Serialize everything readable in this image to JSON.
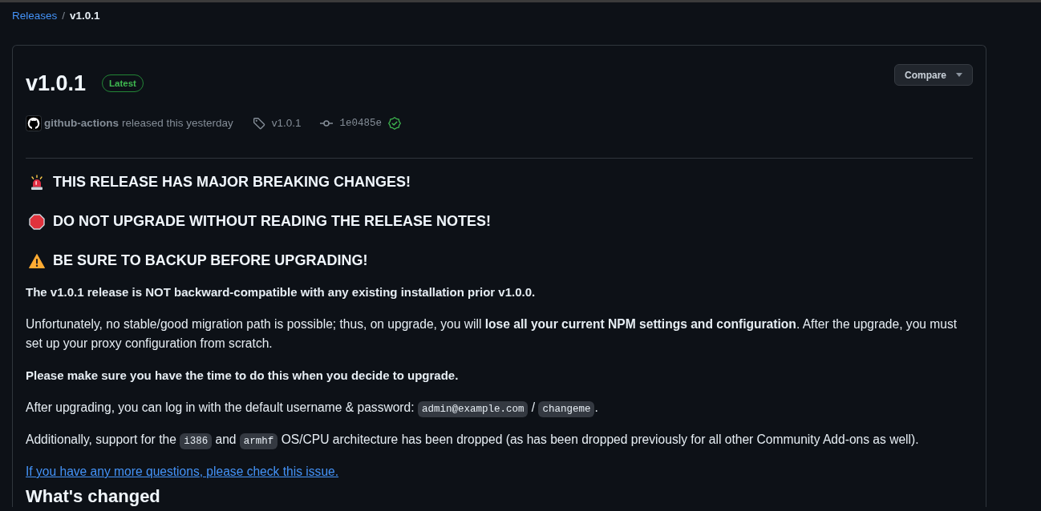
{
  "breadcrumb": {
    "separator": "/",
    "items": [
      {
        "label": "Releases",
        "current": false
      },
      {
        "label": "v1.0.1",
        "current": true
      }
    ]
  },
  "release": {
    "title": "v1.0.1",
    "badge": "Latest",
    "compare_button": {
      "label": "Compare"
    },
    "author": "github-actions",
    "action": "released this yesterday",
    "tag": "v1.0.1",
    "commit": "1e0485e",
    "verified": true
  },
  "body": [
    {
      "kind": "siren",
      "text": "THIS RELEASE HAS MAJOR BREAKING CHANGES!"
    },
    {
      "kind": "stop",
      "text": "DO NOT UPGRADE WITHOUT READING THE RELEASE NOTES!"
    },
    {
      "kind": "warning",
      "text": "BE SURE TO BACKUP BEFORE UPGRADING!"
    },
    {
      "kind": "paragraph",
      "bold": true,
      "text": "The v1.0.1 release is NOT backward-compatible with any existing installation prior v1.0.0."
    },
    {
      "kind": "paragraph",
      "bold": false,
      "text": "Unfortunately, no stable/good migration path is possible; thus, on upgrade, you will **lose all your current NPM settings and configuration**. After the upgrade, you must set up your proxy configuration from scratch."
    },
    {
      "kind": "paragraph",
      "bold": true,
      "text": "Please make sure you have the time to do this when you decide to upgrade."
    },
    {
      "kind": "mixed",
      "parts": [
        {
          "kind": "text",
          "text": "After upgrading, you can log in with the default username & password: "
        },
        {
          "kind": "code",
          "text": "admin@example.com"
        },
        {
          "kind": "text",
          "text": " / "
        },
        {
          "kind": "code",
          "text": "changeme"
        },
        {
          "kind": "text",
          "text": "."
        }
      ]
    },
    {
      "kind": "mixed",
      "parts": [
        {
          "kind": "text",
          "text": "Additionally, support for the "
        },
        {
          "kind": "code",
          "text": "i386"
        },
        {
          "kind": "text",
          "text": " and "
        },
        {
          "kind": "code",
          "text": "armhf"
        },
        {
          "kind": "text",
          "text": " OS/CPU architecture has been dropped (as has been dropped previously for all other Community Add-ons as well)."
        }
      ]
    },
    {
      "kind": "link",
      "text": "If you have any more questions, please check this issue."
    },
    {
      "kind": "heading",
      "text": "What's changed"
    }
  ]
}
